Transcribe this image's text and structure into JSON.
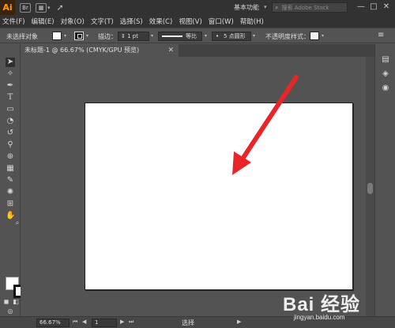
{
  "app": {
    "logo": "Ai",
    "bridge_label": "Br",
    "workspace": "基本功能",
    "stock_search_placeholder": "搜索 Adobe Stock",
    "window_min": "—",
    "window_max": "□",
    "window_close": "✕"
  },
  "menu": [
    "文件(F)",
    "编辑(E)",
    "对象(O)",
    "文字(T)",
    "选择(S)",
    "效果(C)",
    "视图(V)",
    "窗口(W)",
    "帮助(H)"
  ],
  "control_bar": {
    "selection_status": "未选择对象",
    "stroke_label": "描边：",
    "stroke_weight": "1 pt",
    "stroke_profile": "等比",
    "brush": "5 点圆形",
    "opacity_label": "不透明度",
    "style_label": "样式："
  },
  "document": {
    "tab_title": "未标题-1 @ 66.67% (CMYK/GPU 预览)",
    "close_glyph": "✕"
  },
  "status": {
    "zoom": "66.67%",
    "page": "1",
    "mode": "选择"
  },
  "watermark": {
    "brand": "Bai 经验",
    "url": "jingyan.baidu.com"
  },
  "colors": {
    "arrow": "#e8262a",
    "app_bg": "#535353",
    "titlebar": "#323232",
    "artboard": "#ffffff"
  }
}
